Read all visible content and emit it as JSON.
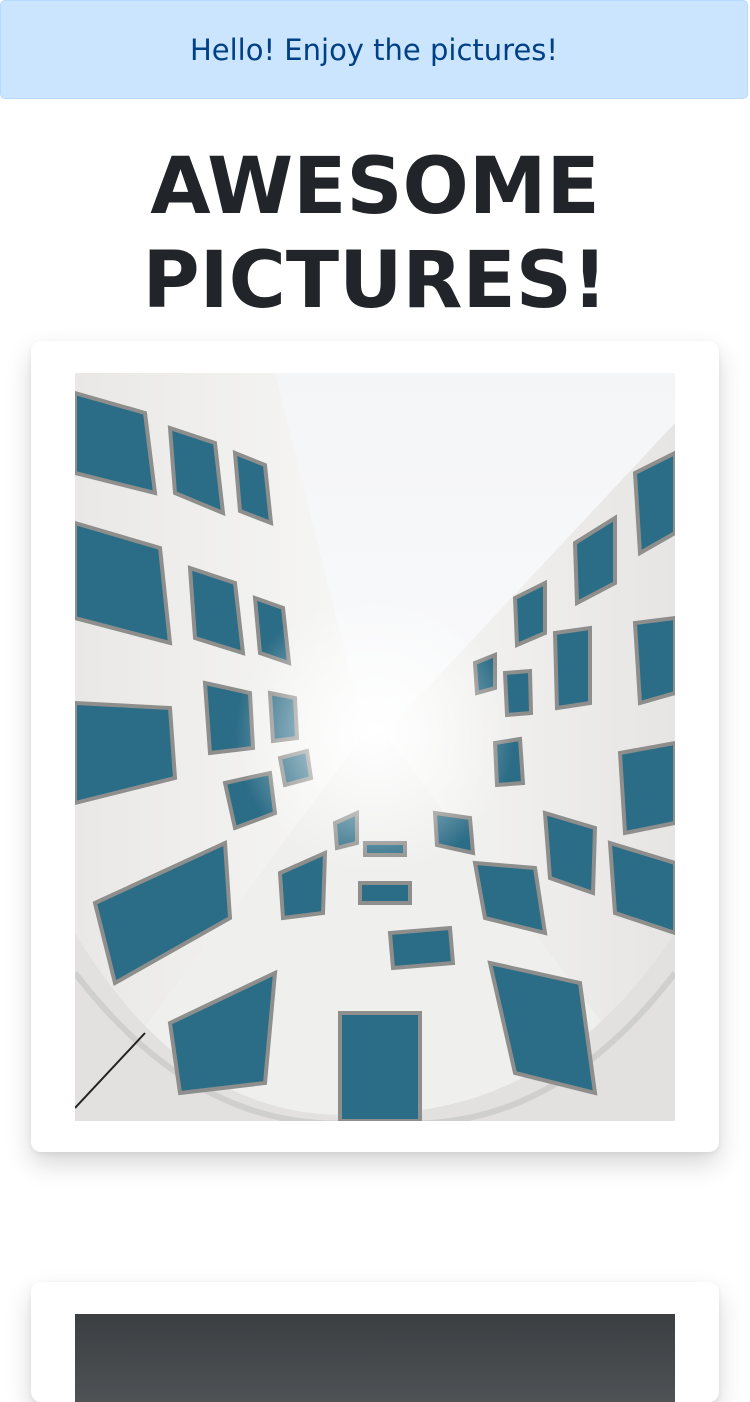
{
  "alert": {
    "text": "Hello! Enjoy the pictures!"
  },
  "page": {
    "title_line1": "AWESOME",
    "title_line2": "PICTURES!"
  },
  "gallery": {
    "items": [
      {
        "image_kind": "architecture-photo-looking-up-between-white-buildings-with-blue-windows"
      },
      {
        "image_kind": "dark-photo-partially-visible"
      }
    ]
  },
  "colors": {
    "alert_bg": "#cce5ff",
    "alert_border": "#b8daff",
    "alert_text": "#004085",
    "title_text": "#212529"
  }
}
